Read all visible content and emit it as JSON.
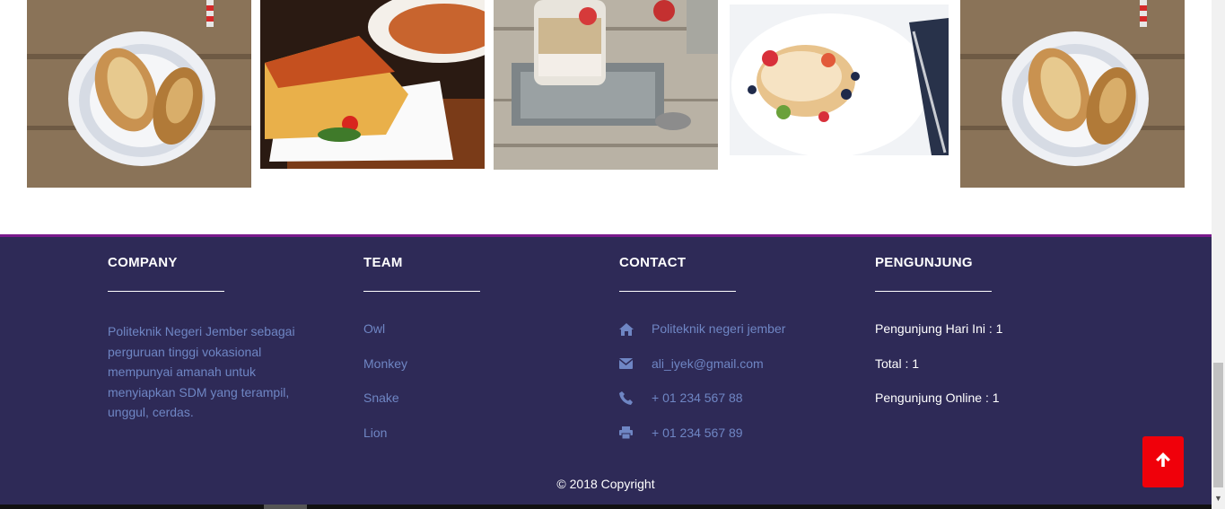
{
  "gallery": {
    "photos": [
      {
        "icon": "bread-rolls-photo"
      },
      {
        "icon": "quiche-photo"
      },
      {
        "icon": "oats-parfait-photo"
      },
      {
        "icon": "pancakes-photo"
      },
      {
        "icon": "bread-rolls-photo"
      }
    ]
  },
  "footer": {
    "background": "#2e2a57",
    "accent": "#7a1a8c",
    "link_color": "#6f86c4",
    "company": {
      "heading": "COMPANY",
      "text": "Politeknik Negeri Jember sebagai perguruan tinggi vokasional mempunyai amanah untuk menyiapkan SDM yang terampil, unggul, cerdas."
    },
    "team": {
      "heading": "TEAM",
      "items": [
        "Owl",
        "Monkey",
        "Snake",
        "Lion"
      ]
    },
    "contact": {
      "heading": "CONTACT",
      "items": [
        {
          "icon": "home-icon",
          "text": "Politeknik negeri jember"
        },
        {
          "icon": "envelope-icon",
          "text": "ali_iyek@gmail.com"
        },
        {
          "icon": "phone-icon",
          "text": "+ 01 234 567 88"
        },
        {
          "icon": "print-icon",
          "text": "+ 01 234 567 89"
        }
      ]
    },
    "visitors": {
      "heading": "PENGUNJUNG",
      "items": [
        "Pengunjung Hari Ini : 1",
        "Total : 1",
        "Pengunjung Online : 1"
      ]
    },
    "copyright": "© 2018 Copyright",
    "back_to_top": {
      "icon": "arrow-up-icon",
      "color": "#f0000a"
    }
  }
}
